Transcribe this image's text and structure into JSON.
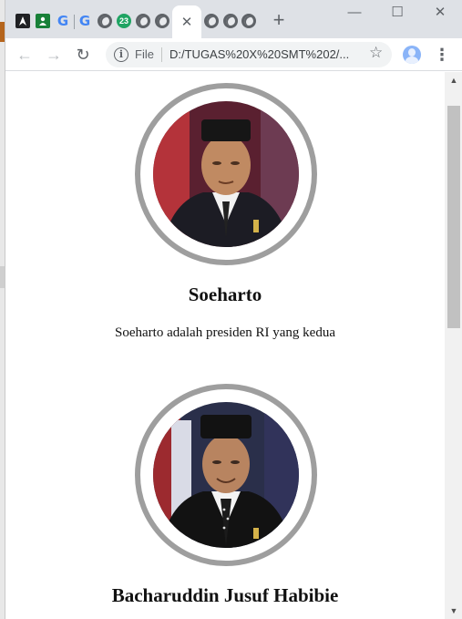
{
  "browser": {
    "tabs": [
      {
        "icon": "bookmark-app-icon"
      },
      {
        "icon": "contacts-icon"
      },
      {
        "icon": "google-icon",
        "glyph": "G"
      },
      {
        "icon": "google-icon",
        "glyph": "G"
      },
      {
        "icon": "globe-icon"
      },
      {
        "icon": "notification-badge-icon",
        "badge": "23"
      },
      {
        "icon": "globe-icon"
      },
      {
        "icon": "globe-icon"
      }
    ],
    "active_tab_close": "✕",
    "tabs_after": [
      {
        "icon": "globe-icon"
      },
      {
        "icon": "globe-icon"
      },
      {
        "icon": "globe-icon"
      }
    ],
    "new_tab_label": "+",
    "window_controls": {
      "minimize": "—",
      "maximize": "☐",
      "close": "✕"
    }
  },
  "toolbar": {
    "back": "←",
    "forward": "→",
    "reload": "↻",
    "scheme_label": "File",
    "url": "D:/TUGAS%20X%20SMT%202/...",
    "bookmark": "☆",
    "menu": "⋮"
  },
  "page": {
    "cards": [
      {
        "name": "Soeharto",
        "description": "Soeharto adalah presiden RI yang kedua"
      },
      {
        "name": "Bacharuddin Jusuf Habibie",
        "description": ""
      }
    ]
  },
  "scrollbar": {
    "up": "▲",
    "down": "▼",
    "position": 0.18
  },
  "colors": {
    "ring": "#9e9e9e",
    "tabstrip": "#dee1e6",
    "accent": "#1a73e8"
  }
}
